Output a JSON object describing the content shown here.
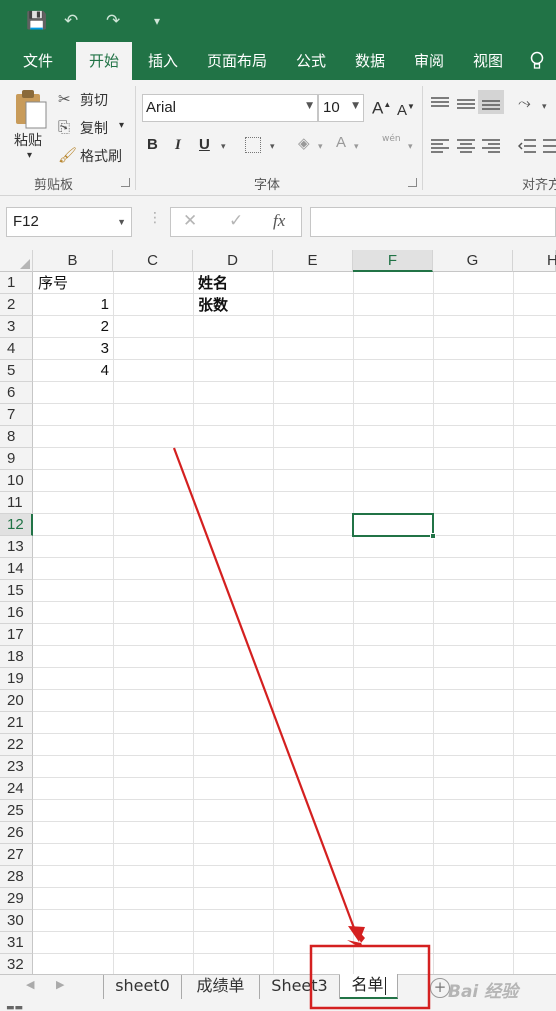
{
  "quick_access": {
    "save": "💾",
    "undo": "↶",
    "redo": "↷",
    "customize": "▾"
  },
  "ribbon_tabs": [
    {
      "label": "文件"
    },
    {
      "label": "开始"
    },
    {
      "label": "插入"
    },
    {
      "label": "页面布局"
    },
    {
      "label": "公式"
    },
    {
      "label": "数据"
    },
    {
      "label": "审阅"
    },
    {
      "label": "视图"
    }
  ],
  "tell_me_icon": "lightbulb-icon",
  "clipboard": {
    "paste_label": "粘贴",
    "cut_label": "剪切",
    "copy_label": "复制",
    "format_painter_label": "格式刷",
    "group_label": "剪贴板"
  },
  "font": {
    "name": "Arial",
    "size": "10",
    "grow": "A",
    "shrink": "A",
    "bold": "B",
    "italic": "I",
    "underline": "U",
    "font_color": "A",
    "phonetic": "wén",
    "group_label": "字体"
  },
  "alignment": {
    "group_label": "对齐方"
  },
  "formula_bar": {
    "name_box": "F12",
    "cancel": "✕",
    "enter": "✓",
    "fx": "fx",
    "value": ""
  },
  "grid": {
    "columns": [
      "B",
      "C",
      "D",
      "E",
      "F",
      "G",
      "H"
    ],
    "rows": [
      "1",
      "2",
      "3",
      "4",
      "5",
      "6",
      "7",
      "8",
      "9",
      "10",
      "11",
      "12",
      "13",
      "14",
      "15",
      "16",
      "17",
      "18",
      "19",
      "20",
      "21",
      "22",
      "23",
      "24",
      "25",
      "26",
      "27",
      "28",
      "29",
      "30",
      "31",
      "32"
    ],
    "cells": {
      "B1": "序号",
      "B2": "1",
      "B3": "2",
      "B4": "3",
      "B5": "4",
      "D1": "姓名",
      "D2": "张数"
    },
    "selected_cell": "F12"
  },
  "sheets": [
    {
      "label": "sheet0"
    },
    {
      "label": "成绩单"
    },
    {
      "label": "Sheet3"
    },
    {
      "label": "名单"
    }
  ],
  "add_sheet": "+",
  "watermark": "Bai 经验",
  "annotation_color": "#d42020",
  "accent_color": "#217346"
}
